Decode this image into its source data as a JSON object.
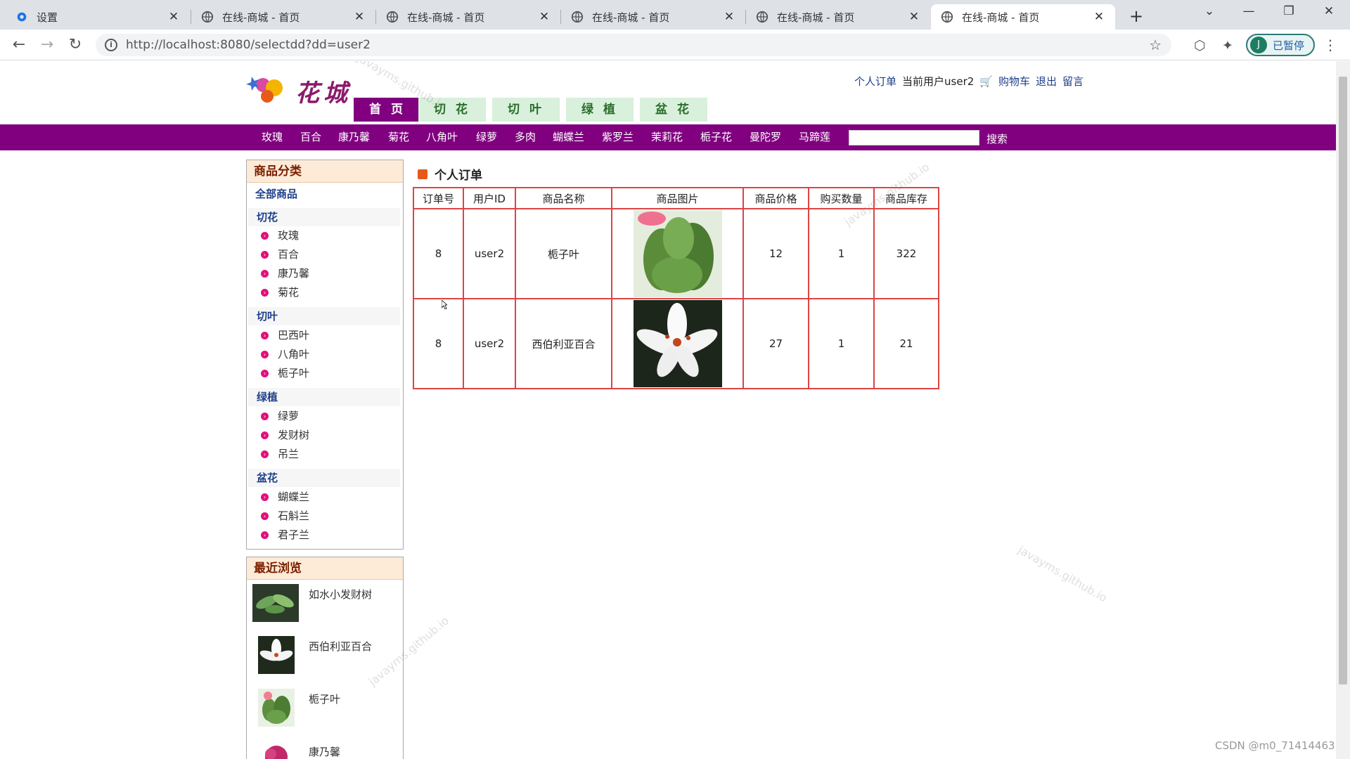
{
  "browser": {
    "tabs": [
      {
        "title": "设置",
        "icon": "gear-icon"
      },
      {
        "title": "在线-商城 - 首页",
        "icon": "globe-icon"
      },
      {
        "title": "在线-商城 - 首页",
        "icon": "globe-icon"
      },
      {
        "title": "在线-商城 - 首页",
        "icon": "globe-icon"
      },
      {
        "title": "在线-商城 - 首页",
        "icon": "globe-icon"
      },
      {
        "title": "在线-商城 - 首页",
        "icon": "globe-icon",
        "active": true
      }
    ],
    "url": "http://localhost:8080/selectdd?dd=user2",
    "profile_initial": "J",
    "profile_label": "已暂停"
  },
  "site": {
    "logo_text": "花城",
    "userbar": {
      "orders": "个人订单",
      "current_user": "当前用户user2",
      "cart": "购物车",
      "logout": "退出",
      "message": "留言"
    },
    "main_tabs": [
      "首 页",
      "切 花",
      "切 叶",
      "绿 植",
      "盆 花"
    ],
    "categories": [
      "玫瑰",
      "百合",
      "康乃馨",
      "菊花",
      "八角叶",
      "绿萝",
      "多肉",
      "蝴蝶兰",
      "紫罗兰",
      "茉莉花",
      "栀子花",
      "曼陀罗",
      "马蹄莲"
    ],
    "search_button": "搜索",
    "search_placeholder": ""
  },
  "sidebar": {
    "title": "商品分类",
    "all": "全部商品",
    "groups": [
      {
        "name": "切花",
        "items": [
          "玫瑰",
          "百合",
          "康乃馨",
          "菊花"
        ]
      },
      {
        "name": "切叶",
        "items": [
          "巴西叶",
          "八角叶",
          "栀子叶"
        ]
      },
      {
        "name": "绿植",
        "items": [
          "绿萝",
          "发财树",
          "吊兰"
        ]
      },
      {
        "name": "盆花",
        "items": [
          "蝴蝶兰",
          "石斛兰",
          "君子兰"
        ]
      }
    ]
  },
  "recent": {
    "title": "最近浏览",
    "items": [
      "如水小发财树",
      "西伯利亚百合",
      "栀子叶",
      "康乃馨"
    ]
  },
  "orders": {
    "title": "个人订单",
    "headers": [
      "订单号",
      "用户ID",
      "商品名称",
      "商品图片",
      "商品价格",
      "购买数量",
      "商品库存"
    ],
    "rows": [
      {
        "order_no": "8",
        "user_id": "user2",
        "name": "栀子叶",
        "price": "12",
        "qty": "1",
        "stock": "322"
      },
      {
        "order_no": "8",
        "user_id": "user2",
        "name": "西伯利亚百合",
        "price": "27",
        "qty": "1",
        "stock": "21"
      }
    ]
  },
  "watermark": "javayms.github.io",
  "credit": "CSDN @m0_71414463",
  "colors": {
    "brand_purple": "#800080",
    "tab_green_bg": "#d8f0dc",
    "table_border": "#dd4444"
  }
}
